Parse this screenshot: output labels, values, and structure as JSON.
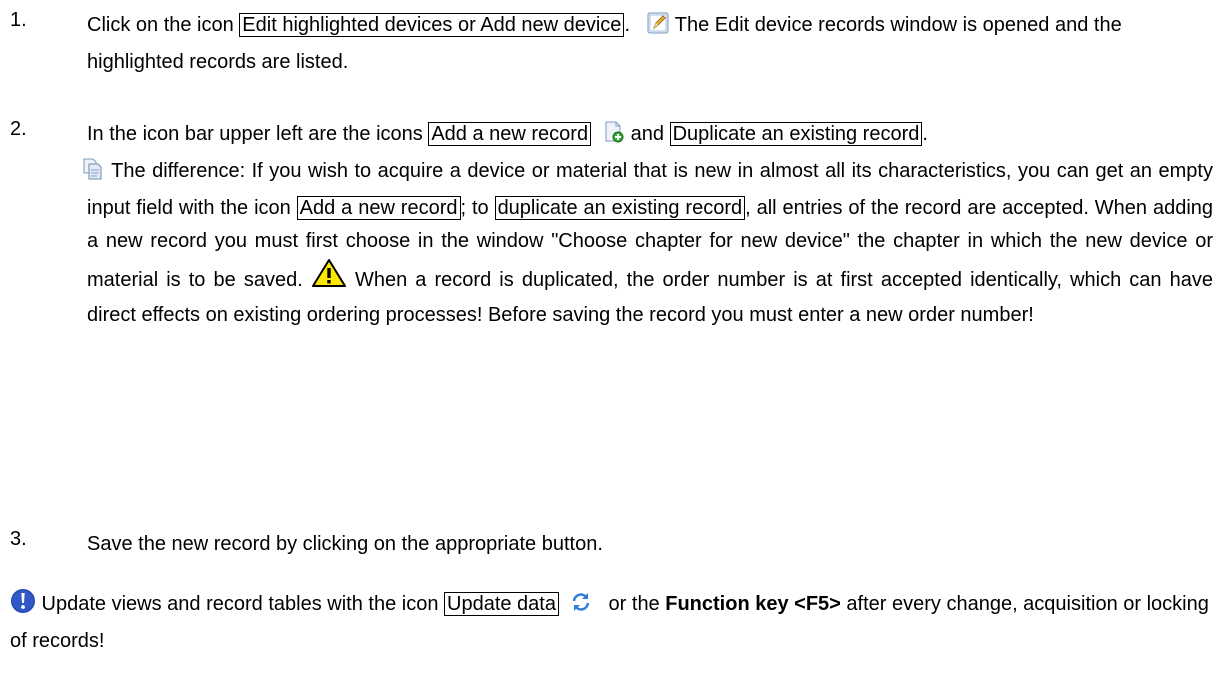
{
  "step1": {
    "number": "1.",
    "text_a": "Click on the icon ",
    "ui": "Edit highlighted devices or Add new device",
    "text_b": ". ",
    "icon": "edit-icon",
    "text_c": " The Edit device records window is opened and the highlighted records are listed."
  },
  "step2": {
    "number": "2.",
    "text_a": "In the icon bar upper left are the icons ",
    "ui_add": "Add a new record",
    "icon_add": "add-record-icon",
    "text_b": " and ",
    "ui_dup": "Duplicate an existing record",
    "text_c": ".",
    "icon_dup": "duplicate-record-icon",
    "text_d": " The difference: If you wish to acquire a device or material that is new in almost all its characteristics, you can get an empty input field with the icon ",
    "ui_add2": "Add a new record",
    "text_e": "; to ",
    "ui_dup2": "duplicate an existing record",
    "text_f": ", all entries of the record are accepted. When adding a new record you must first choose in the window \"Choose chapter for new device\" the chapter in which the new device or material is to be saved. ",
    "icon_warn": "warning-icon",
    "text_g": " When a record is duplicated, the order number  is at first accepted identically, which can have direct effects on existing ordering processes! Before saving the record you must enter a new order number!"
  },
  "step3": {
    "number": "3.",
    "text": "Save the new record by clicking on the appropriate button."
  },
  "note": {
    "icon": "important-icon",
    "text_a": " Update views and record tables with the icon ",
    "ui": "Update data",
    "icon_update": "refresh-icon",
    "text_b": " or the ",
    "bold": "Function key <F5>",
    "text_c": " after every change, acquisition or locking of records!"
  }
}
